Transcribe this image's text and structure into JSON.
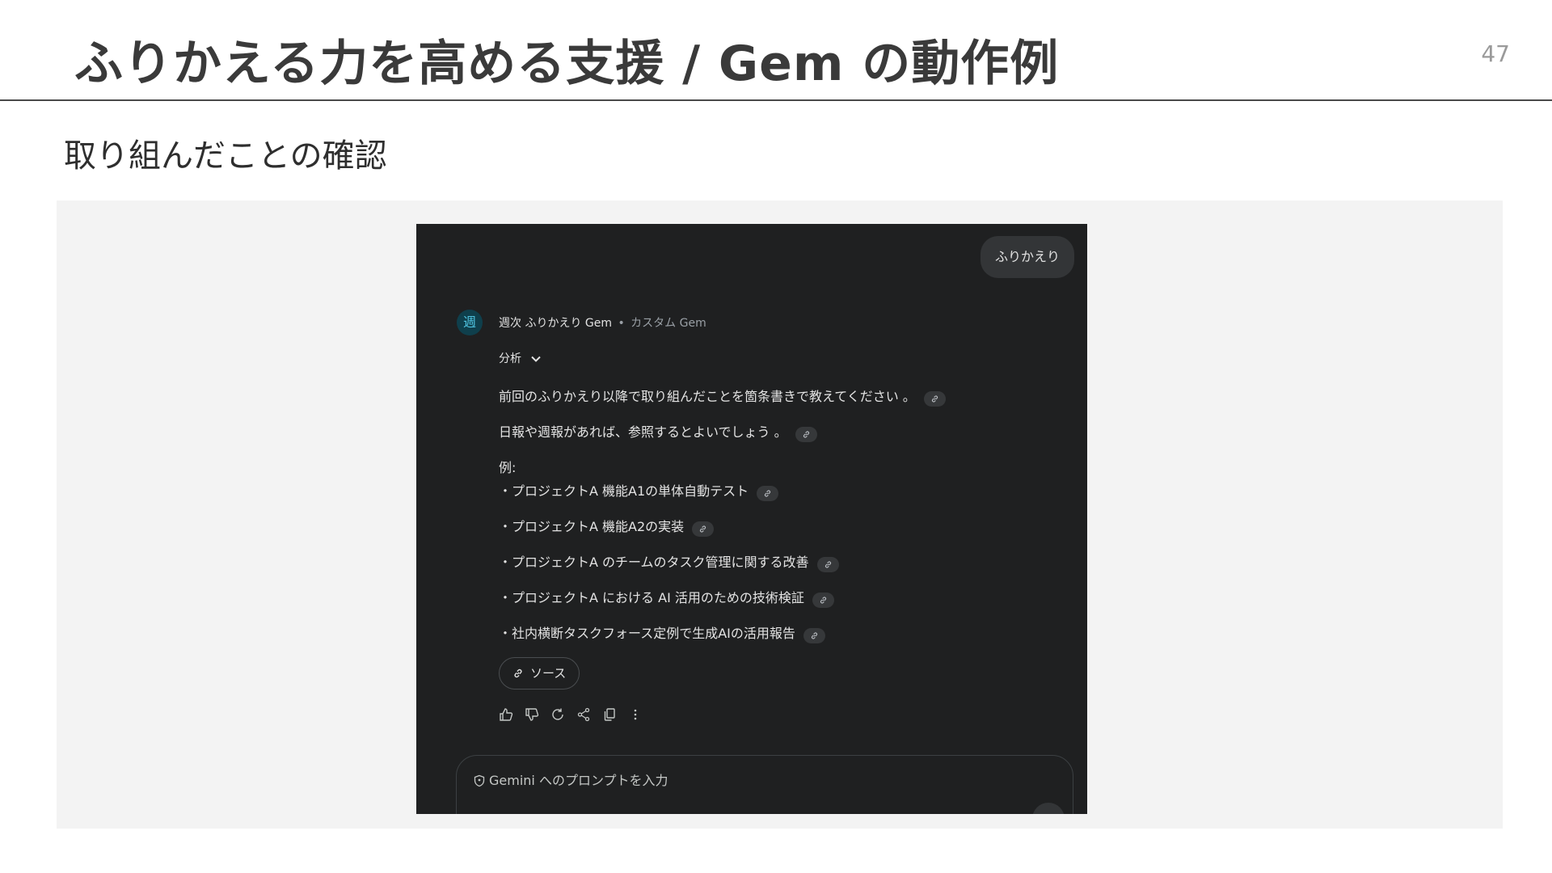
{
  "slide": {
    "title": "ふりかえる力を高める支援 / Gem の動作例",
    "page_number": "47",
    "subtitle": "取り組んだことの確認"
  },
  "chat": {
    "user_message": "ふりかえり",
    "gem_avatar_glyph": "週",
    "gem_name": "週次 ふりかえり Gem",
    "gem_separator": "•",
    "gem_type": "カスタム Gem",
    "analysis_label": "分析",
    "response_lines": [
      "前回のふりかえり以降で取り組んだことを箇条書きで教えてください 。",
      "日報や週報があれば、参照するとよいでしょう 。",
      "例:",
      "・プロジェクトA 機能A1の単体自動テスト",
      "・プロジェクトA 機能A2の実装",
      "・プロジェクトA のチームのタスク管理に関する改善",
      "・プロジェクトA における AI 活用のための技術検証",
      "・社内横断タスクフォース定例で生成AIの活用報告"
    ],
    "source_label": "ソース",
    "action_icons": [
      "thumbs-up-icon",
      "thumbs-down-icon",
      "refresh-icon",
      "share-icon",
      "copy-icon",
      "more-vert-icon"
    ],
    "prompt_placeholder": "Gemini へのプロンプトを入力"
  },
  "colors": {
    "screenshot_bg": "#1f2021",
    "panel_bg": "#f3f3f3",
    "avatar_accent": "#4fc3e0"
  }
}
